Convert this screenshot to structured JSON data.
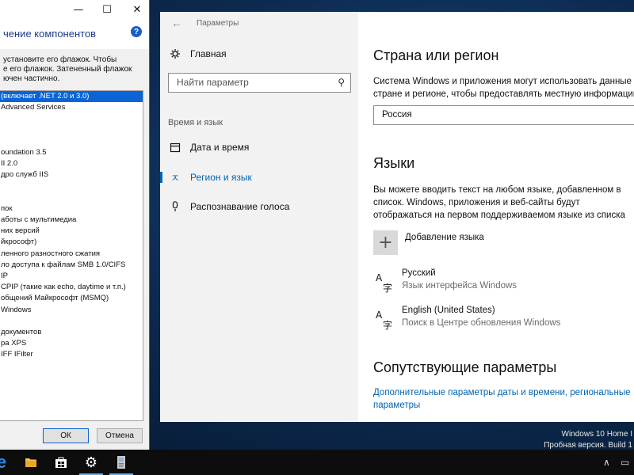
{
  "features_dialog": {
    "title_buttons": [
      "—",
      "☐",
      "✕"
    ],
    "header_title": "чение компонентов",
    "help_label": "?",
    "description": [
      "установите его флажок. Чтобы",
      "е его флажок. Затененный флажок",
      "ючен частично."
    ],
    "tree_items": [
      "(включает .NET 2.0 и 3.0)",
      "Advanced Services",
      "",
      "",
      "",
      "oundation 3.5",
      "II 2.0",
      "дро служб IIS",
      "",
      "",
      "пок",
      "аботы с мультимедиа",
      "них версий",
      "йкрософт)",
      "ленного разностного сжатия",
      "ло доступа к файлам SMB 1.0/CIFS",
      "IP",
      "CPIP (такие как echo, daytime и т.п.)",
      "общений Майкрософт (MSMQ)",
      "Windows",
      "",
      "документов",
      "ра XPS",
      "IFF IFilter"
    ],
    "ok_label": "ОК",
    "cancel_label": "Отмена"
  },
  "settings": {
    "app_title": "Параметры",
    "nav": {
      "home_label": "Главная",
      "search_placeholder": "Найти параметр",
      "group_label": "Время и язык",
      "items": [
        {
          "label": "Дата и время"
        },
        {
          "label": "Регион и язык"
        },
        {
          "label": "Распознавание голоса"
        }
      ]
    },
    "region": {
      "heading": "Страна или регион",
      "description": [
        "Система Windows и приложения могут использовать данные",
        "стране и регионе, чтобы предоставлять местную информацию"
      ],
      "country_value": "Россия"
    },
    "languages": {
      "heading": "Языки",
      "description": [
        "Вы можете вводить текст на любом языке, добавленном в",
        "список. Windows, приложения и веб-сайты будут",
        "отображаться на первом поддерживаемом языке из списка"
      ],
      "add_label": "Добавление языка",
      "items": [
        {
          "name": "Русский",
          "sub": "Язык интерфейса Windows"
        },
        {
          "name": "English (United States)",
          "sub": "Поиск в Центре обновления Windows"
        }
      ]
    },
    "related": {
      "heading": "Сопутствующие параметры",
      "link_lines": [
        "Дополнительные параметры даты и времени, региональные",
        "параметры"
      ]
    }
  },
  "watermark": {
    "line1": "Windows 10 Home I",
    "line2": "Пробная версия. Build 1"
  },
  "colors": {
    "accent": "#0063b1",
    "selection": "#0a64d8"
  }
}
